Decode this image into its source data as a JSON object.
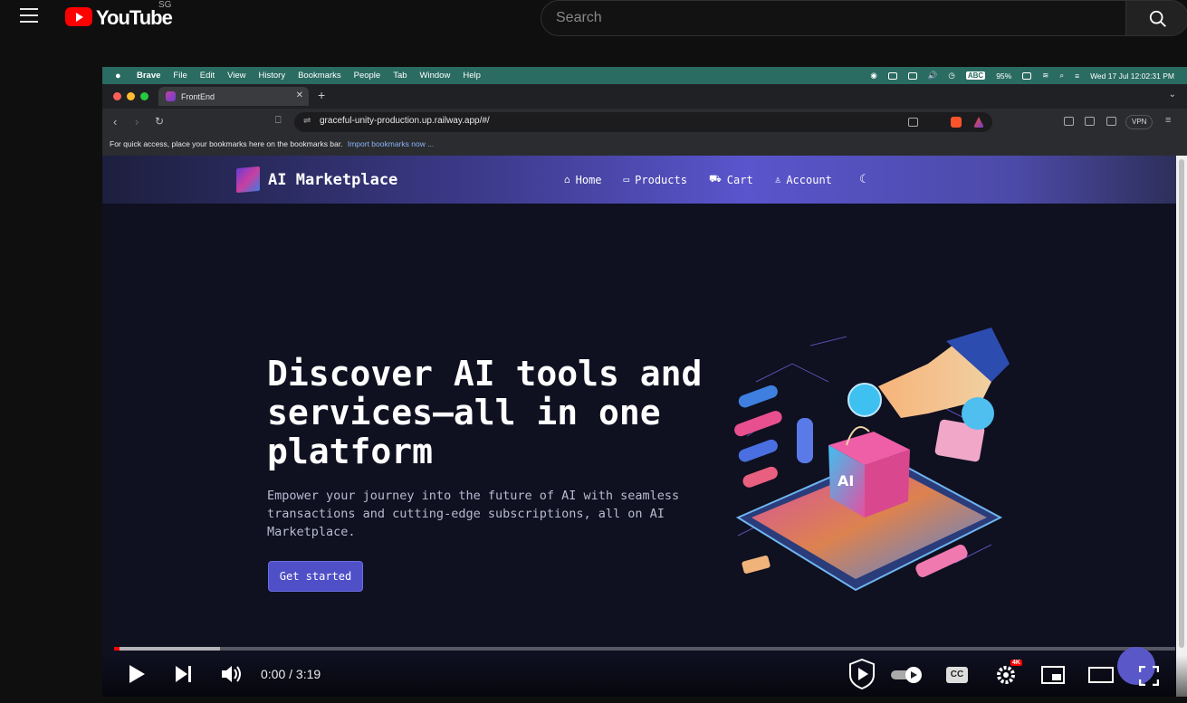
{
  "youtube": {
    "logo_text": "YouTube",
    "region": "SG",
    "search_placeholder": "Search"
  },
  "mac_menubar": {
    "app": "Brave",
    "menus": [
      "File",
      "Edit",
      "View",
      "History",
      "Bookmarks",
      "People",
      "Tab",
      "Window",
      "Help"
    ],
    "input_source": "ABC",
    "battery": "95%",
    "datetime": "Wed 17 Jul  12:02:31 PM"
  },
  "browser": {
    "tab_title": "FrontEnd",
    "url": "graceful-unity-production.up.railway.app/#/",
    "vpn_label": "VPN",
    "bookmarks_hint": "For quick access, place your bookmarks here on the bookmarks bar.",
    "bookmarks_link": "Import bookmarks now ..."
  },
  "site": {
    "brand": "AI Marketplace",
    "nav": [
      {
        "label": "Home",
        "icon": "home-icon"
      },
      {
        "label": "Products",
        "icon": "archive-icon"
      },
      {
        "label": "Cart",
        "icon": "cart-icon"
      },
      {
        "label": "Account",
        "icon": "user-icon"
      }
    ],
    "theme_toggle_icon": "moon-icon",
    "hero_title": "Discover AI tools and services—all in one platform",
    "hero_subtitle": "Empower your journey into the future of AI with seamless transactions and cutting-edge subscriptions, all on AI Marketplace.",
    "cta": "Get started",
    "accent_color": "#4f4fc7"
  },
  "player": {
    "time": "0:00 / 3:19",
    "progress_played": 0,
    "progress_buffered": 0.1,
    "cc_label": "CC",
    "quality_badge": "4K"
  }
}
